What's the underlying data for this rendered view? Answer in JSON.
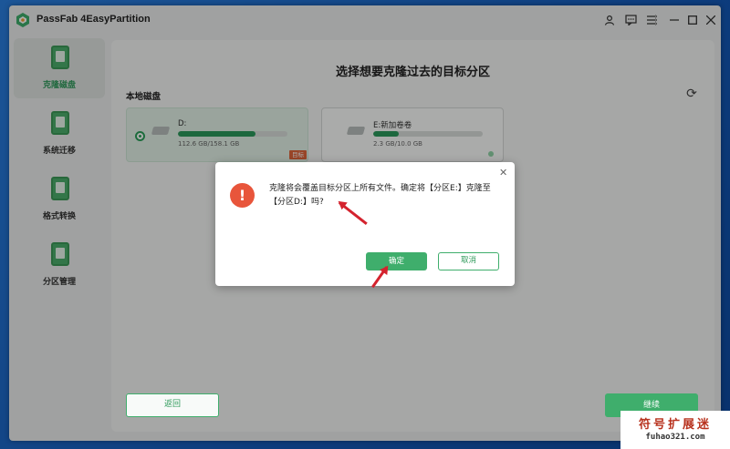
{
  "app": {
    "title": "PassFab 4EasyPartition"
  },
  "sidebar": {
    "items": [
      {
        "label": "克隆磁盘",
        "icon": "clone-disk-icon",
        "active": true
      },
      {
        "label": "系统迁移",
        "icon": "system-migrate-icon",
        "active": false
      },
      {
        "label": "格式转换",
        "icon": "format-convert-icon",
        "active": false
      },
      {
        "label": "分区管理",
        "icon": "partition-manage-icon",
        "active": false
      }
    ]
  },
  "main": {
    "title": "选择想要克隆过去的目标分区",
    "section_label": "本地磁盘",
    "disks": [
      {
        "name": "D:",
        "size": "112.6 GB/158.1 GB",
        "used_fraction": 0.71,
        "badge": "目标",
        "selected": true
      },
      {
        "name": "E:新加卷卷",
        "size": "2.3 GB/10.0 GB",
        "used_fraction": 0.23,
        "selected": false
      }
    ],
    "back_label": "返回",
    "next_label": "继续"
  },
  "dialog": {
    "message": "克隆将会覆盖目标分区上所有文件。确定将【分区E:】克隆至【分区D:】吗?",
    "ok_label": "确定",
    "cancel_label": "取消",
    "close_glyph": "✕",
    "warning_glyph": "!"
  },
  "watermark": {
    "line1": "符号扩展迷",
    "line2": "fuhao321.com"
  },
  "colors": {
    "accent": "#3fae6c",
    "warning": "#e8553b",
    "badge": "#e0663c",
    "arrow": "#d4232e"
  }
}
